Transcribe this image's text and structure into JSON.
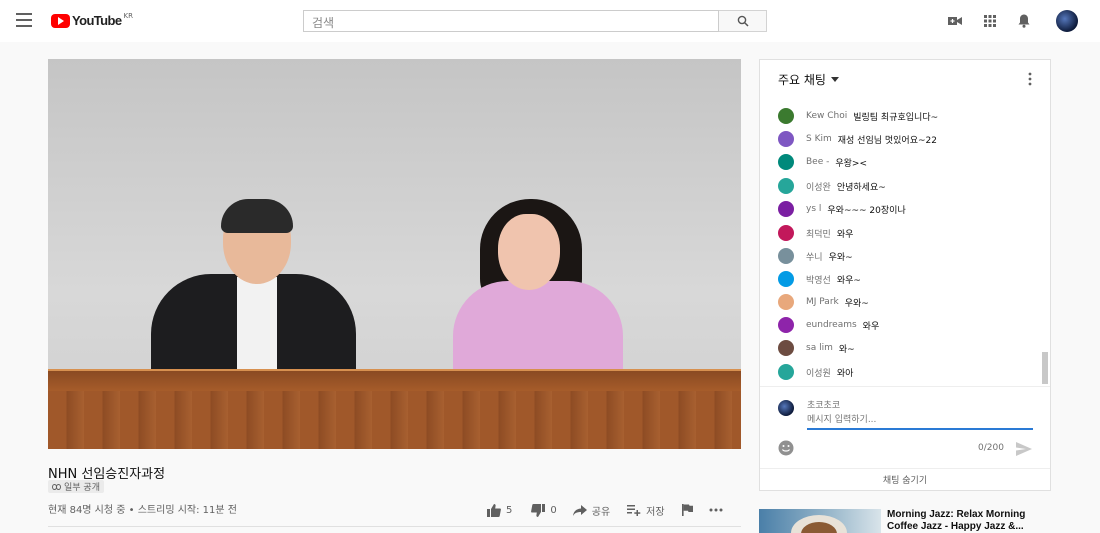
{
  "header": {
    "logo_text": "YouTube",
    "region": "KR",
    "search_placeholder": "검색",
    "icons": [
      "menu-icon",
      "search-icon",
      "create-video-icon",
      "apps-grid-icon",
      "notifications-bell-icon",
      "account-avatar"
    ]
  },
  "video": {
    "title": "NHN 선임승진자과정",
    "visibility": "일부 공개",
    "meta": "현재 84명 시청 중 • 스트리밍 시작: 11분 전",
    "likes": "5",
    "dislikes": "0",
    "share_label": "공유",
    "save_label": "저장"
  },
  "chat": {
    "title": "주요 채팅",
    "messages": [
      {
        "author": "Kew Choi",
        "text": "빌링팀 최규호입니다~",
        "color": "#3b7a2f"
      },
      {
        "author": "S Kim",
        "text": "재성 선임님 멋있어요~22",
        "color": "#7e57c2"
      },
      {
        "author": "Bee -",
        "text": "우왕><",
        "color": "#00897b"
      },
      {
        "author": "이성완",
        "text": "안녕하세요~",
        "color": "#26a69a"
      },
      {
        "author": "ys l",
        "text": "우와~~~ 20장이나",
        "color": "#7b1fa2"
      },
      {
        "author": "최덕민",
        "text": "와우",
        "color": "#c2185b"
      },
      {
        "author": "쑤니",
        "text": "우와~",
        "color": "#78909c"
      },
      {
        "author": "박영선",
        "text": "와우~",
        "color": "#039be5"
      },
      {
        "author": "MJ Park",
        "text": "우와~",
        "color": "#e8a87c"
      },
      {
        "author": "eundreams",
        "text": "와우",
        "color": "#8e24aa"
      },
      {
        "author": "sa lim",
        "text": "와~",
        "color": "#6d4c41"
      },
      {
        "author": "이성원",
        "text": "와아",
        "color": "#26a69a"
      }
    ],
    "self_name": "초코초코",
    "input_placeholder": "메시지 입력하기...",
    "char_count": "0/200",
    "hide_label": "채팅 숨기기"
  },
  "recommendation": {
    "title": "Morning Jazz: Relax Morning Coffee Jazz - Happy Jazz &..."
  }
}
